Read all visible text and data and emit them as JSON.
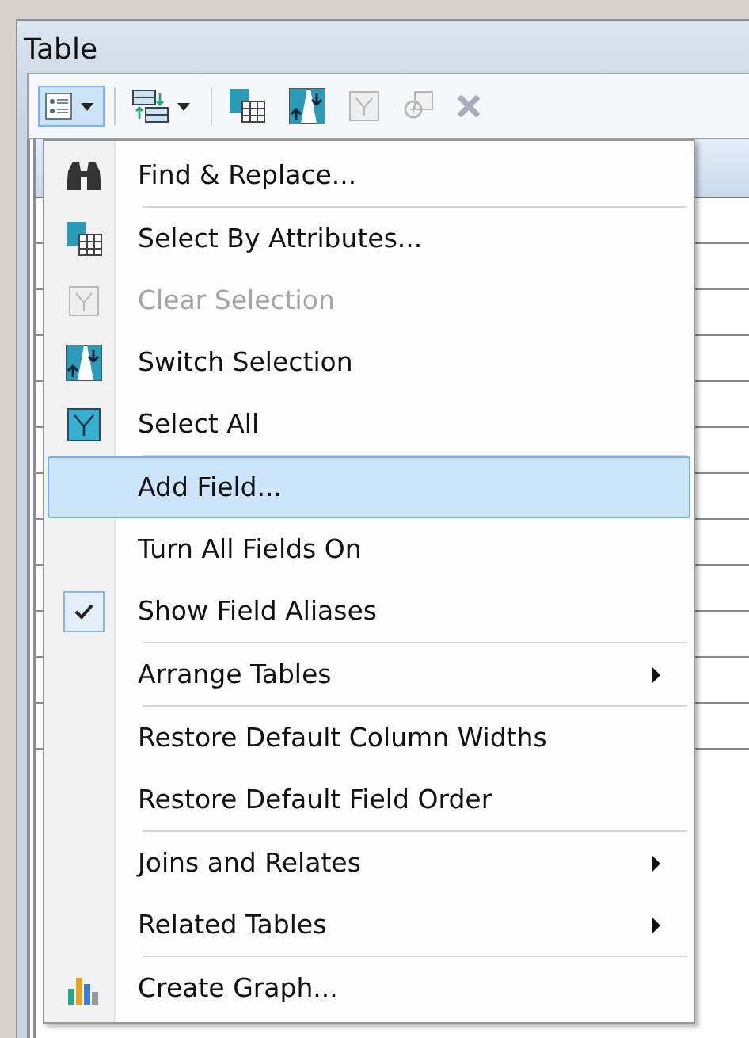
{
  "window": {
    "title": "Table"
  },
  "toolbar": {
    "buttons": [
      {
        "kind": "table-options",
        "dropdown": true,
        "selected": true
      },
      {
        "kind": "related",
        "dropdown": true,
        "selected": false
      },
      {
        "kind": "select-by-attributes",
        "dropdown": false,
        "selected": false
      },
      {
        "kind": "switch-selection",
        "dropdown": false,
        "selected": false
      },
      {
        "kind": "clear-selection",
        "dropdown": false,
        "selected": false,
        "disabled": true
      },
      {
        "kind": "zoom-selected",
        "dropdown": false,
        "selected": false,
        "disabled": true
      },
      {
        "kind": "delete",
        "dropdown": false,
        "selected": false,
        "disabled": true
      }
    ]
  },
  "menu": {
    "items": [
      {
        "kind": "item",
        "label": "Find & Replace...",
        "disabled": false,
        "checked": false,
        "submenu": false,
        "selected": false
      },
      {
        "kind": "separator"
      },
      {
        "kind": "item",
        "label": "Select By Attributes...",
        "disabled": false,
        "checked": false,
        "submenu": false,
        "selected": false
      },
      {
        "kind": "item",
        "label": "Clear Selection",
        "disabled": true,
        "checked": false,
        "submenu": false,
        "selected": false
      },
      {
        "kind": "item",
        "label": "Switch Selection",
        "disabled": false,
        "checked": false,
        "submenu": false,
        "selected": false
      },
      {
        "kind": "item",
        "label": "Select All",
        "disabled": false,
        "checked": false,
        "submenu": false,
        "selected": false
      },
      {
        "kind": "separator"
      },
      {
        "kind": "item",
        "label": "Add Field...",
        "disabled": false,
        "checked": false,
        "submenu": false,
        "selected": true
      },
      {
        "kind": "item",
        "label": "Turn All Fields On",
        "disabled": false,
        "checked": false,
        "submenu": false,
        "selected": false
      },
      {
        "kind": "item",
        "label": "Show Field Aliases",
        "disabled": false,
        "checked": true,
        "submenu": false,
        "selected": false
      },
      {
        "kind": "separator"
      },
      {
        "kind": "item",
        "label": "Arrange Tables",
        "disabled": false,
        "checked": false,
        "submenu": true,
        "selected": false
      },
      {
        "kind": "separator"
      },
      {
        "kind": "item",
        "label": "Restore Default Column Widths",
        "disabled": false,
        "checked": false,
        "submenu": false,
        "selected": false
      },
      {
        "kind": "item",
        "label": "Restore Default Field Order",
        "disabled": false,
        "checked": false,
        "submenu": false,
        "selected": false
      },
      {
        "kind": "separator"
      },
      {
        "kind": "item",
        "label": "Joins and Relates",
        "disabled": false,
        "checked": false,
        "submenu": true,
        "selected": false
      },
      {
        "kind": "item",
        "label": "Related Tables",
        "disabled": false,
        "checked": false,
        "submenu": true,
        "selected": false
      },
      {
        "kind": "separator"
      },
      {
        "kind": "item",
        "label": "Create Graph...",
        "disabled": false,
        "checked": false,
        "submenu": false,
        "selected": false
      }
    ]
  }
}
